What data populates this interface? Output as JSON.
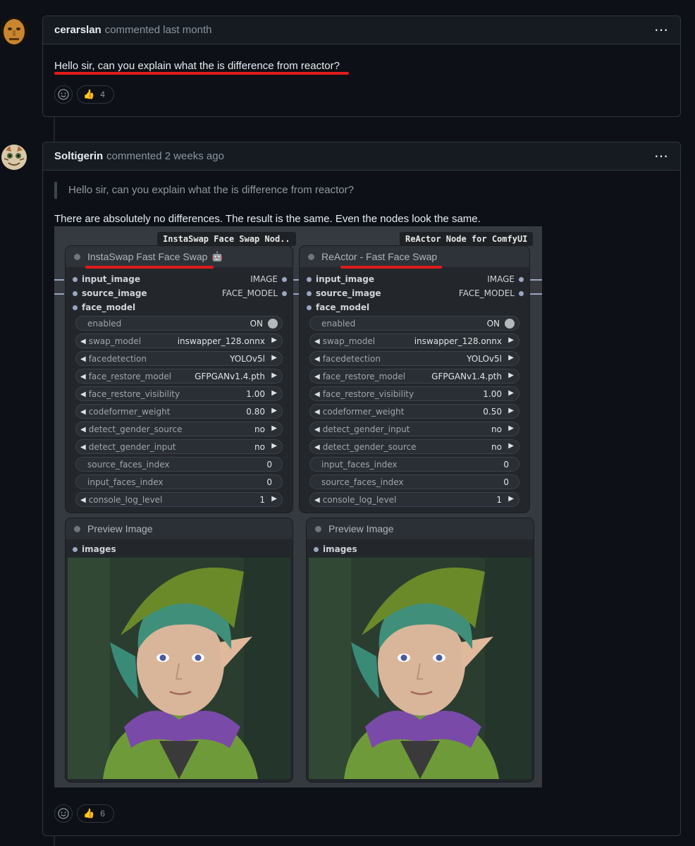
{
  "comments": [
    {
      "author": "cerarslan",
      "meta": "commented last month",
      "menu_icon": "⋯",
      "body": "Hello sir, can you explain what the is difference from reactor?",
      "reactions": {
        "thumbs_up": "4"
      }
    },
    {
      "author": "Soltigerin",
      "meta": "commented 2 weeks ago",
      "menu_icon": "⋯",
      "quote": "Hello sir, can you explain what the is difference from reactor?",
      "body": "There are absolutely no differences. The result is the same. Even the nodes look the same.",
      "reactions": {
        "thumbs_up": "6"
      }
    }
  ],
  "comfy": {
    "left_tag": "InstaSwap Face Swap Nod..",
    "right_tag": "ReActor Node for ComfyUI",
    "left_node": {
      "title": "InstaSwap Fast Face Swap",
      "title_emoji": "🤖",
      "inputs": [
        "input_image",
        "source_image",
        "face_model"
      ],
      "outputs": [
        "IMAGE",
        "FACE_MODEL"
      ],
      "enabled_label": "enabled",
      "enabled_value": "ON",
      "widgets": [
        {
          "name": "swap_model",
          "value": "inswapper_128.onnx",
          "arrows": true
        },
        {
          "name": "facedetection",
          "value": "YOLOv5l",
          "arrows": true
        },
        {
          "name": "face_restore_model",
          "value": "GFPGANv1.4.pth",
          "arrows": true
        },
        {
          "name": "face_restore_visibility",
          "value": "1.00",
          "arrows": true
        },
        {
          "name": "codeformer_weight",
          "value": "0.80",
          "arrows": true
        },
        {
          "name": "detect_gender_source",
          "value": "no",
          "arrows": true
        },
        {
          "name": "detect_gender_input",
          "value": "no",
          "arrows": true
        },
        {
          "name": "source_faces_index",
          "value": "0",
          "arrows": false
        },
        {
          "name": "input_faces_index",
          "value": "0",
          "arrows": false
        },
        {
          "name": "console_log_level",
          "value": "1",
          "arrows": true
        }
      ]
    },
    "right_node": {
      "title": "ReActor - Fast Face Swap",
      "inputs": [
        "input_image",
        "source_image",
        "face_model"
      ],
      "outputs": [
        "IMAGE",
        "FACE_MODEL"
      ],
      "enabled_label": "enabled",
      "enabled_value": "ON",
      "widgets": [
        {
          "name": "swap_model",
          "value": "inswapper_128.onnx",
          "arrows": true
        },
        {
          "name": "facedetection",
          "value": "YOLOv5l",
          "arrows": true
        },
        {
          "name": "face_restore_model",
          "value": "GFPGANv1.4.pth",
          "arrows": true
        },
        {
          "name": "face_restore_visibility",
          "value": "1.00",
          "arrows": true
        },
        {
          "name": "codeformer_weight",
          "value": "0.50",
          "arrows": true
        },
        {
          "name": "detect_gender_input",
          "value": "no",
          "arrows": true
        },
        {
          "name": "detect_gender_source",
          "value": "no",
          "arrows": true
        },
        {
          "name": "input_faces_index",
          "value": "0",
          "arrows": false
        },
        {
          "name": "source_faces_index",
          "value": "0",
          "arrows": false
        },
        {
          "name": "console_log_level",
          "value": "1",
          "arrows": true
        }
      ]
    },
    "preview": {
      "title": "Preview Image",
      "input": "images"
    }
  },
  "colors": {
    "background": "#0d1117",
    "header": "#161b22",
    "border": "#30363d",
    "underline": "#e21b1b"
  }
}
